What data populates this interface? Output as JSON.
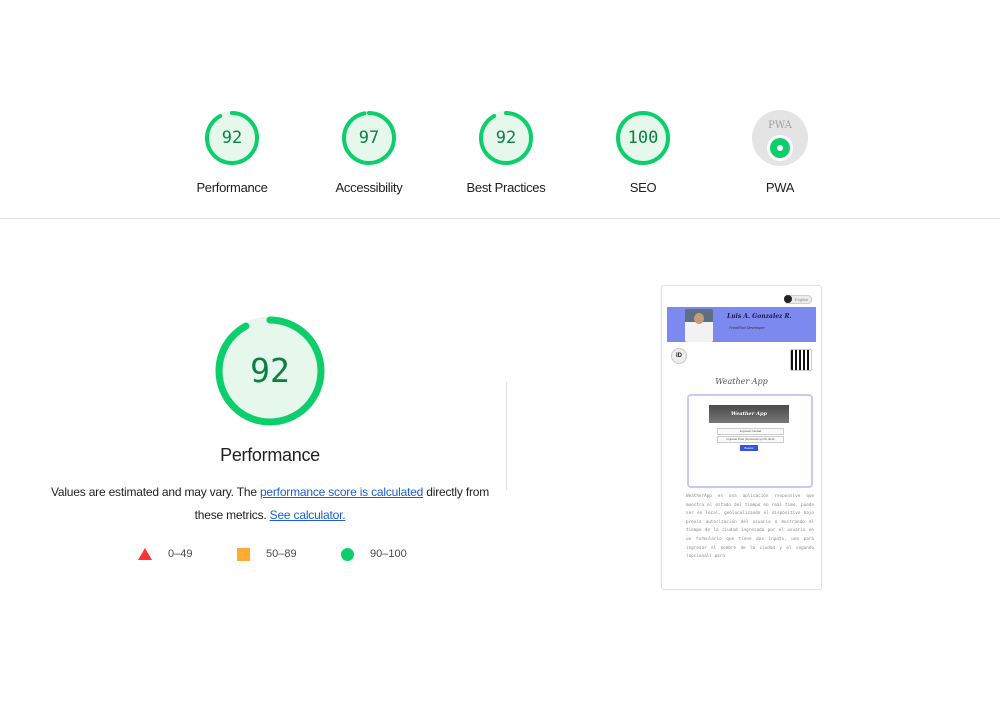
{
  "categories": [
    {
      "score": "92",
      "score_value": 92,
      "label": "Performance"
    },
    {
      "score": "97",
      "score_value": 97,
      "label": "Accessibility"
    },
    {
      "score": "92",
      "score_value": 92,
      "label": "Best Practices"
    },
    {
      "score": "100",
      "score_value": 100,
      "label": "SEO"
    },
    {
      "label": "PWA",
      "badge_text": "PWA"
    }
  ],
  "main": {
    "score": "92",
    "score_value": 92,
    "title": "Performance",
    "desc_before": "Values are estimated and may vary. The ",
    "desc_link1": "performance score is calculated",
    "desc_mid": " directly from these metrics. ",
    "desc_link2": "See calculator."
  },
  "legend": [
    {
      "shape": "triangle",
      "range": "0–49",
      "color": "#ff3333"
    },
    {
      "shape": "square",
      "range": "50–89",
      "color": "#ffaa33"
    },
    {
      "shape": "circle",
      "range": "90–100",
      "color": "#0cce6b"
    }
  ],
  "screenshot": {
    "toggle_label": "English",
    "name": "Luis A. Gonzalez R.",
    "subtitle": "FrontEnd Developer",
    "id_icon": "ID",
    "app_title": "Weather App",
    "card_title": "Weather App",
    "input1": "Ingresar Ciudad",
    "input2": "Ingresar Pais (Opcional) ej:US, EUA",
    "button": "Buscar",
    "paragraph": "WeatherApp es una aplicación responsive que muestra el estado del tiempo en real time, puede ser en local, geolocalizando el dispositivo bajo previa autorización del usuario o mostrando el tiempo de la ciudad ingresada por el usuario en un formulario que tiene dos inputs, uno para ingresar el nombre de la ciudad y el segundo (opcional) para"
  },
  "colors": {
    "pass": "#0cce6b",
    "pass_text": "#0b8043",
    "pass_fill": "#e6f7ec",
    "link": "#1a5fd6"
  }
}
